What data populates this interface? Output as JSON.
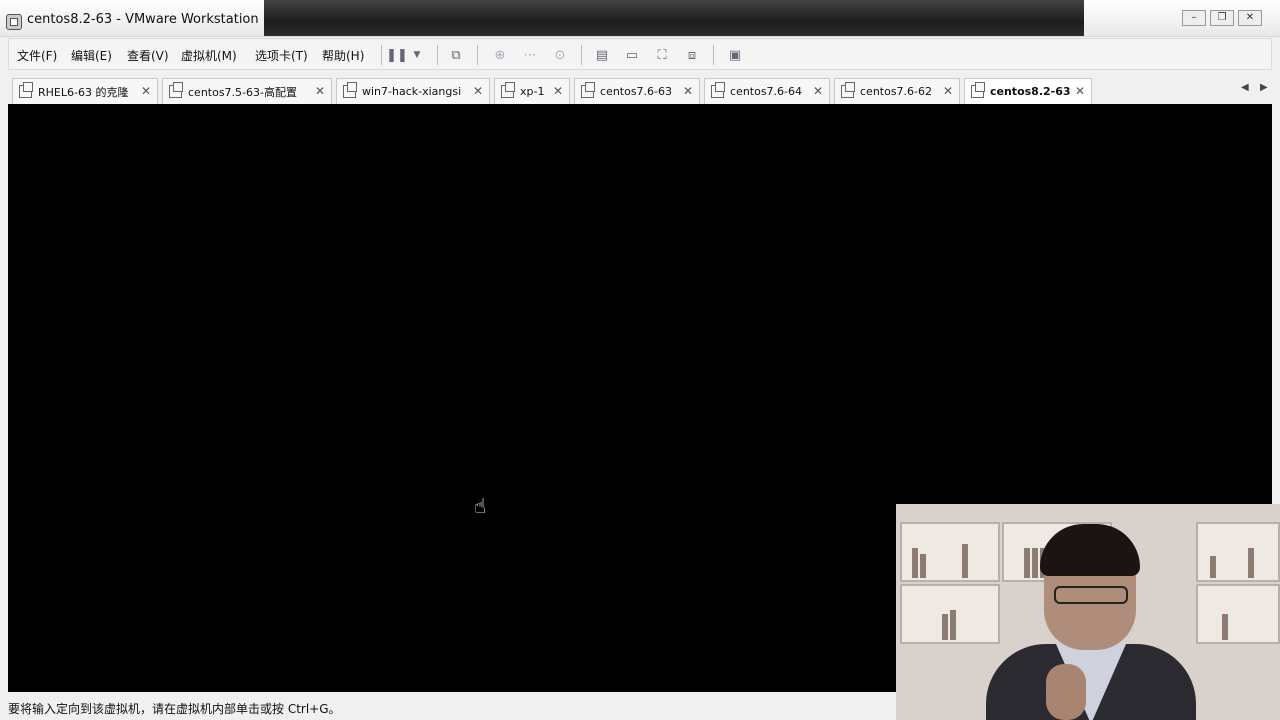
{
  "window": {
    "title": "centos8.2-63 - VMware Workstation",
    "controls": [
      "minimize",
      "restore",
      "close"
    ]
  },
  "menu": {
    "items": [
      {
        "label": "文件(F)"
      },
      {
        "label": "编辑(E)"
      },
      {
        "label": "查看(V)"
      },
      {
        "label": "虚拟机(M)"
      },
      {
        "label": "选项卡(T)"
      },
      {
        "label": "帮助(H)"
      }
    ]
  },
  "toolbar": {
    "icons": [
      "pause-icon",
      "dropdown-arrow-icon",
      "send-ctrl-alt-del-icon",
      "snapshot-icon",
      "revert-snapshot-icon",
      "snapshot-manager-icon",
      "library-icon",
      "console-view-icon",
      "fullscreen-icon",
      "unity-icon",
      "thumbnail-view-icon"
    ]
  },
  "tabs": [
    {
      "label": "RHEL6-63 的克隆",
      "active": false
    },
    {
      "label": "centos7.5-63-高配置",
      "active": false
    },
    {
      "label": "win7-hack-xiangsi",
      "active": false
    },
    {
      "label": "xp-1",
      "active": false
    },
    {
      "label": "centos7.6-63",
      "active": false
    },
    {
      "label": "centos7.6-64",
      "active": false
    },
    {
      "label": "centos7.6-62",
      "active": false
    },
    {
      "label": "centos8.2-63",
      "active": true
    }
  ],
  "status": {
    "text": "要将输入定向到该虚拟机，请在虚拟机内部单击或按 Ctrl+G。"
  },
  "colors": {
    "console_bg": "#000000",
    "chrome_bg": "#f0f0f0"
  }
}
